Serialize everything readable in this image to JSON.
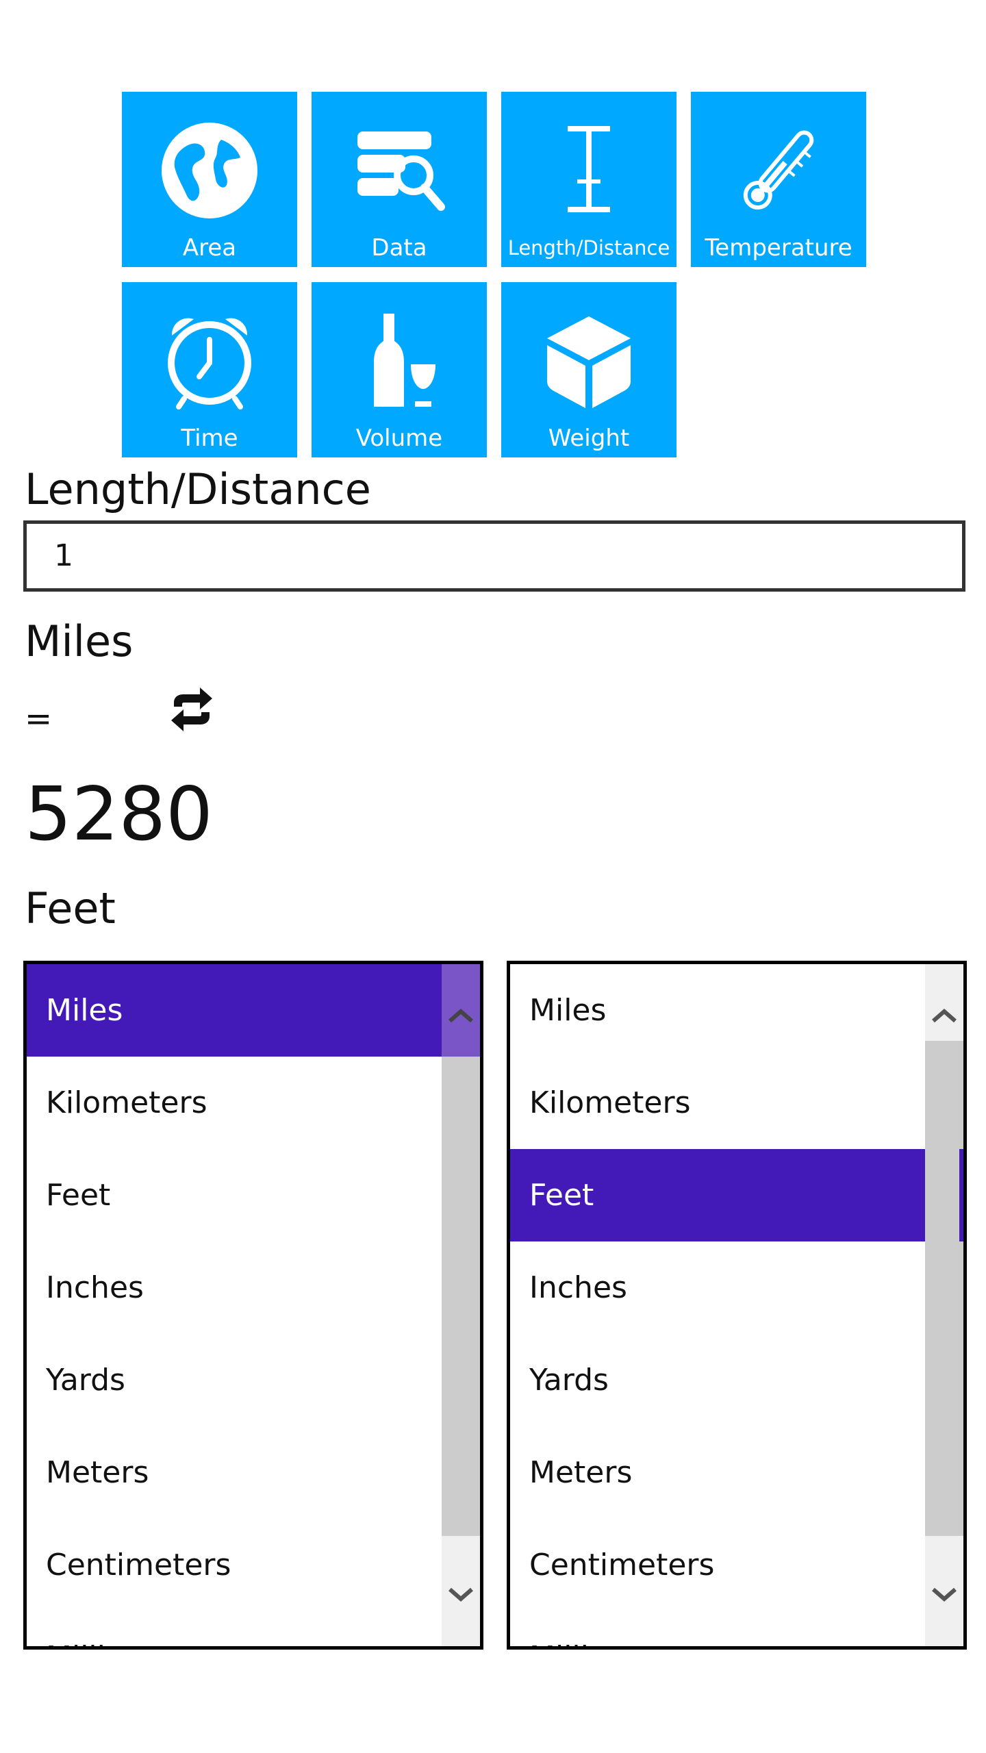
{
  "tiles": [
    {
      "label": "Area",
      "icon": "globe-icon"
    },
    {
      "label": "Data",
      "icon": "data-search-icon"
    },
    {
      "label": "Length/Distance",
      "icon": "length-icon"
    },
    {
      "label": "Temperature",
      "icon": "thermometer-icon"
    },
    {
      "label": "Time",
      "icon": "alarm-clock-icon"
    },
    {
      "label": "Volume",
      "icon": "bottle-glass-icon"
    },
    {
      "label": "Weight",
      "icon": "cube-icon"
    }
  ],
  "category_title": "Length/Distance",
  "input_value": "1",
  "from_unit": "Miles",
  "equals": "=",
  "result": "5280",
  "to_unit": "Feet",
  "units": [
    "Miles",
    "Kilometers",
    "Feet",
    "Inches",
    "Yards",
    "Meters",
    "Centimeters",
    "Millimeters"
  ],
  "from_list": {
    "selected": "Miles"
  },
  "to_list": {
    "selected": "Feet"
  },
  "colors": {
    "tile": "#00a8ff",
    "selection": "#4319b8"
  }
}
